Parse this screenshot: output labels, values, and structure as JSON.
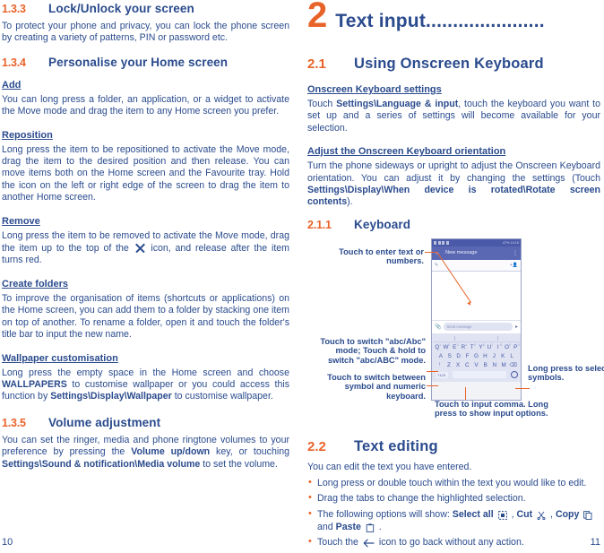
{
  "left_column": {
    "section_133": {
      "num": "1.3.3",
      "title": "Lock/Unlock your screen",
      "body": "To protect your phone and privacy, you can lock the phone screen by creating a variety of patterns, PIN or password etc."
    },
    "section_134": {
      "num": "1.3.4",
      "title": "Personalise your Home screen",
      "add_heading": "Add",
      "add_body": "You can long press a folder, an application, or a widget to activate the Move mode and drag the item to any Home screen you prefer.",
      "reposition_heading": "Reposition",
      "reposition_body": "Long press the item to be repositioned to activate the Move mode, drag the item to the desired position and then release. You can move items both on the Home screen and the Favourite tray. Hold the icon on the left or right edge of the screen to drag the item to another Home screen.",
      "remove_heading": "Remove",
      "remove_body_a": "Long press the item to be removed to activate the Move mode, drag the item up to the top of the",
      "remove_body_b": "icon, and release after the item turns red.",
      "create_folders_heading": "Create folders",
      "create_folders_body": "To improve the organisation of items (shortcuts or applications) on the Home screen, you can add them to a folder by stacking one item on top of another. To rename a folder, open it and touch the folder's title bar to input the new name.",
      "wallpaper_heading": "Wallpaper customisation",
      "wallpaper_body_1": "Long press the empty space in the Home screen and choose ",
      "wallpaper_bold_1": "WALLPAPERS",
      "wallpaper_body_2": " to customise wallpaper or you could access this function by ",
      "wallpaper_bold_2": "Settings\\Display\\Wallpaper",
      "wallpaper_body_3": " to customise wallpaper."
    },
    "section_135": {
      "num": "1.3.5",
      "title": "Volume adjustment",
      "body_1": "You can set the ringer, media and phone ringtone volumes to your preference by pressing the ",
      "bold_1": "Volume up/down",
      "body_2": " key, or touching ",
      "bold_2": "Settings\\Sound & notification\\Media volume",
      "body_3": " to set the volume."
    },
    "page_number": "10"
  },
  "right_column": {
    "chapter": {
      "number": "2",
      "title": "Text input......................"
    },
    "section_21": {
      "num": "2.1",
      "title": "Using Onscreen Keyboard",
      "settings_heading": "Onscreen Keyboard settings",
      "settings_body_1": "Touch ",
      "settings_bold_1": "Settings\\Language & input",
      "settings_body_2": ", touch the keyboard you want to set up and a series of settings will become available for your selection.",
      "orientation_heading": "Adjust the Onscreen Keyboard orientation",
      "orientation_body_1": "Turn the phone sideways or upright to adjust the Onscreen Keyboard orientation. You can adjust it by changing the settings (Touch ",
      "orientation_bold_1": "Settings\\Display\\When device is rotated\\Rotate screen contents",
      "orientation_body_2": ")."
    },
    "section_211": {
      "num": "2.1.1",
      "title": "Keyboard"
    },
    "figure": {
      "annotations": {
        "enter_text": "Touch to enter text or numbers.",
        "abc_mode": "Touch to switch  \"abc/Abc\" mode; Touch & hold to switch \"abc/ABC\" mode.",
        "symbol_numeric": "Touch to switch between symbol and numeric keyboard.",
        "comma": "Touch to input comma. Long press to show input options.",
        "long_press_symbols": "Long press to select symbols."
      },
      "phone": {
        "status_battery": "47%",
        "status_time": "14:15",
        "app_title": "New message",
        "composer_placeholder": "Send message",
        "keyboard_row1": [
          {
            "letter": "Q",
            "sup": "1"
          },
          {
            "letter": "W",
            "sup": "2"
          },
          {
            "letter": "E",
            "sup": "3"
          },
          {
            "letter": "R",
            "sup": "4"
          },
          {
            "letter": "T",
            "sup": "5"
          },
          {
            "letter": "Y",
            "sup": "6"
          },
          {
            "letter": "U",
            "sup": "7"
          },
          {
            "letter": "I",
            "sup": "8"
          },
          {
            "letter": "O",
            "sup": "9"
          },
          {
            "letter": "P",
            "sup": "0"
          }
        ],
        "keyboard_row2": [
          "A",
          "S",
          "D",
          "F",
          "G",
          "H",
          "J",
          "K",
          "L"
        ],
        "keyboard_row3": [
          "Z",
          "X",
          "C",
          "V",
          "B",
          "N",
          "M"
        ],
        "shift_key": "↑",
        "backspace_key": "⌫",
        "numeric_key": "?123",
        "emoji_key": "smiley-icon"
      }
    },
    "section_22": {
      "num": "2.2",
      "title": "Text editing",
      "intro": "You can edit the text you have entered.",
      "bullets": [
        {
          "text": "Long press or double touch within the text you would like to edit."
        },
        {
          "text": "Drag the tabs to change the highlighted selection."
        },
        {
          "text": "The following options will show: ",
          "bold_1": "Select all",
          "mid_1": " , ",
          "bold_2": "Cut",
          "mid_2": " , ",
          "bold_3": "Copy",
          "mid_3": " and ",
          "bold_4": "Paste",
          "mid_4": " ."
        },
        {
          "text_a": "Touch the ",
          "text_b": " icon to go back without any action."
        }
      ]
    },
    "page_number": "11"
  },
  "colors": {
    "accent_orange": "#E8632A",
    "heading_blue": "#2A4B8D",
    "phone_appbar": "#5a68b4",
    "phone_keyboard_bg": "#dfe3f2"
  }
}
